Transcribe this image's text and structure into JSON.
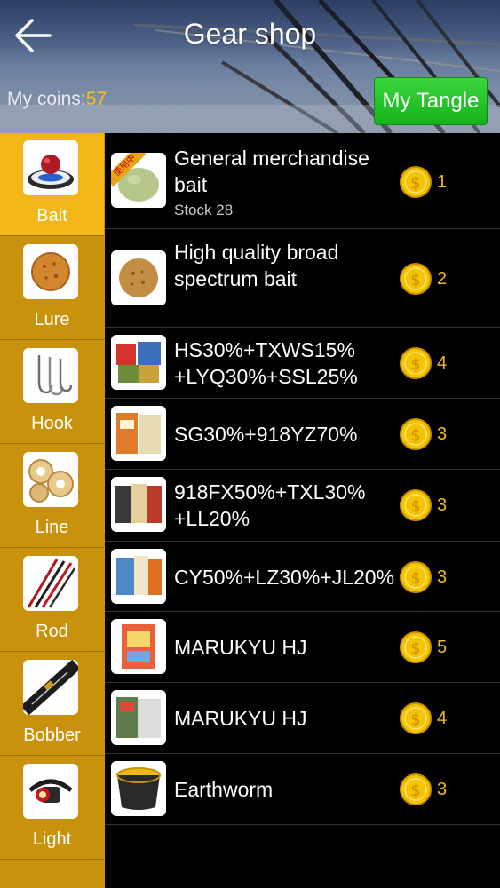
{
  "header": {
    "title": "Gear shop",
    "coins_label": "My coins:",
    "coins_value": "57",
    "my_tangle_label": "My Tangle",
    "back_icon": "arrow-left-icon"
  },
  "sidebar": {
    "active": "Bait",
    "items": [
      {
        "label": "Bait",
        "icon": "bait-icon"
      },
      {
        "label": "Lure",
        "icon": "lure-icon"
      },
      {
        "label": "Hook",
        "icon": "hook-icon"
      },
      {
        "label": "Line",
        "icon": "line-icon"
      },
      {
        "label": "Rod",
        "icon": "rod-icon"
      },
      {
        "label": "Bobber",
        "icon": "bobber-icon"
      },
      {
        "label": "Light",
        "icon": "light-icon"
      }
    ]
  },
  "products": [
    {
      "name": "General merchandise bait",
      "stock_label": "Stock",
      "stock": "28",
      "price": "1",
      "badge": "使用中"
    },
    {
      "name": "High quality broad spectrum bait",
      "price": "2"
    },
    {
      "name": "HS30%+TXWS15% +LYQ30%+SSL25%",
      "price": "4"
    },
    {
      "name": "SG30%+918YZ70%",
      "price": "3"
    },
    {
      "name": "918FX50%+TXL30% +LL20%",
      "price": "3"
    },
    {
      "name": "CY50%+LZ30%+JL20%",
      "price": "3"
    },
    {
      "name": "MARUKYU HJ",
      "price": "5"
    },
    {
      "name": "MARUKYU HJ",
      "price": "4"
    },
    {
      "name": "Earthworm",
      "price": "3"
    }
  ],
  "colors": {
    "sidebar": "#c9920c",
    "sidebar_active": "#f2b619",
    "price": "#f0b81e",
    "coins_value": "#f3c11a",
    "my_tangle_button": "#22c425"
  }
}
